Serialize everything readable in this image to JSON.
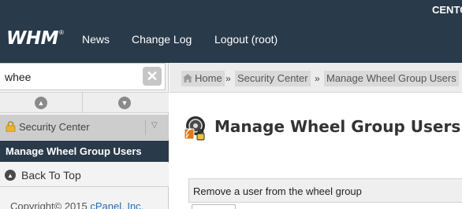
{
  "topbar": {
    "hostname": "CENTOS",
    "logo_text": "WHM",
    "logo_mark": "®",
    "nav": {
      "news": "News",
      "change_log": "Change Log",
      "logout": "Logout (root)"
    },
    "background_color": "#293a4a"
  },
  "sidebar": {
    "search": {
      "value": "whee",
      "clear_icon": "close-icon"
    },
    "collapse": {
      "up_icon": "arrow-up-icon",
      "down_icon": "arrow-down-icon"
    },
    "category": {
      "label": "Security Center",
      "icon": "lock-icon",
      "toggle_icon": "chevron-down-icon"
    },
    "active_item": {
      "label": "Manage Wheel Group Users"
    },
    "back_to_top": {
      "label": "Back To Top",
      "icon": "arrow-up-circle-icon"
    },
    "copyright": {
      "text": "Copyright© 2015 ",
      "link": "cPanel, Inc."
    }
  },
  "breadcrumb": {
    "home": "Home",
    "separator": "»",
    "security_center": "Security Center",
    "current": "Manage Wheel Group Users"
  },
  "main": {
    "title": "Manage Wheel Group Users",
    "title_icon": "wheel-group-lock-icon",
    "panel": {
      "heading": "Remove a user from the wheel group"
    }
  }
}
